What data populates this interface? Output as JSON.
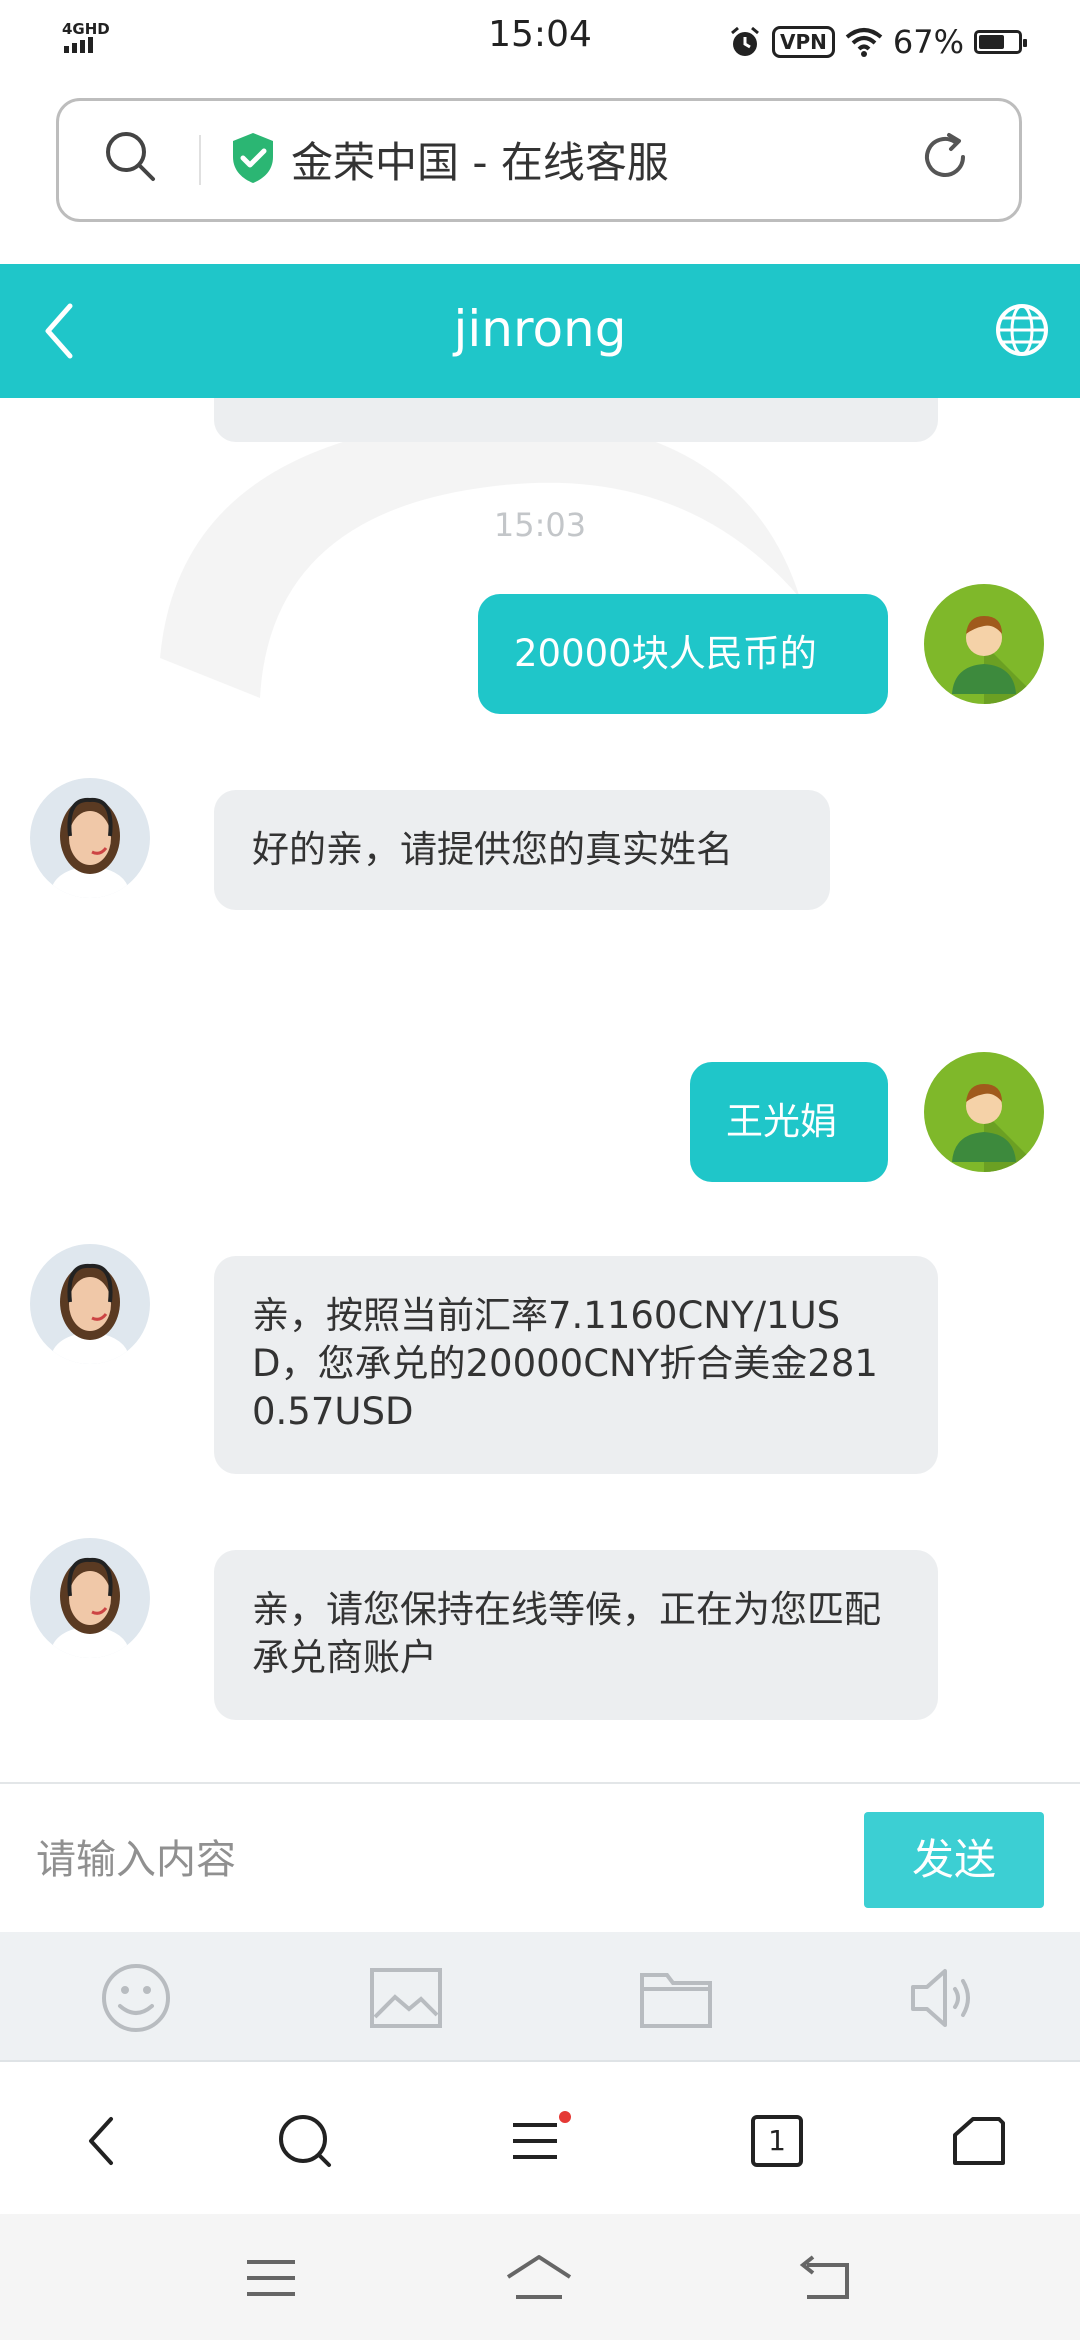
{
  "status_bar": {
    "network": "4GHD",
    "time": "15:04",
    "vpn": "VPN",
    "battery": "67%",
    "battery_level": 0.67
  },
  "browser": {
    "page_title": "金荣中国 - 在线客服"
  },
  "header": {
    "title": "jinrong"
  },
  "messages": [
    {
      "from": "agent",
      "text": ""
    },
    {
      "type": "timestamp",
      "text": "15:03"
    },
    {
      "from": "user",
      "text": "20000块人民币的"
    },
    {
      "from": "agent",
      "text": "好的亲，请提供您的真实姓名"
    },
    {
      "from": "user",
      "text": "王光娟"
    },
    {
      "from": "agent",
      "text": "亲，按照当前汇率7.1160CNY/1USD，您承兑的20000CNY折合美金2810.57USD"
    },
    {
      "from": "agent",
      "text": "亲，请您保持在线等候，正在为您匹配承兑商账户"
    }
  ],
  "composer": {
    "placeholder": "请输入内容",
    "send_label": "发送"
  },
  "tabs_count": "1",
  "colors": {
    "accent": "#1fc6c9",
    "agent_bubble": "#eceef0",
    "notification_dot": "#e53935"
  }
}
